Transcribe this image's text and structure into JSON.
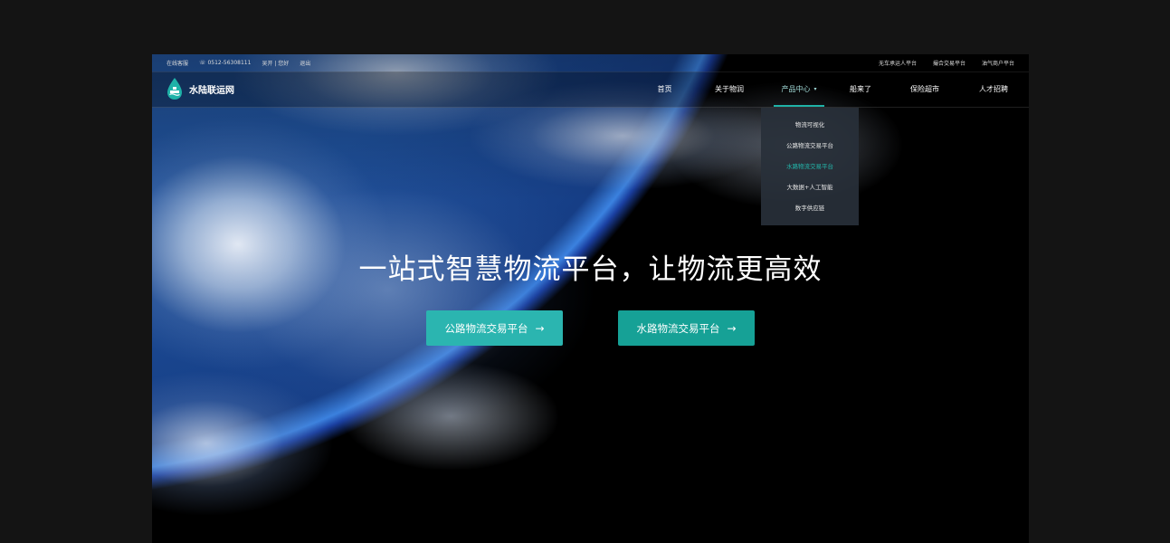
{
  "topbar": {
    "service": "在线客服",
    "phone": "0512-56308111",
    "user": "吴开 | 您好",
    "logout": "退出",
    "links": [
      "无车承运人平台",
      "撮合交易平台",
      "油气商户平台"
    ]
  },
  "brand": {
    "name": "水陆联运网"
  },
  "nav": {
    "items": [
      "首页",
      "关于物润",
      "产品中心",
      "船来了",
      "保险超市",
      "人才招聘"
    ],
    "active_index": 2
  },
  "dropdown": {
    "items": [
      "物流可视化",
      "公路物流交易平台",
      "水路物流交易平台",
      "大数据+人工智能",
      "数字供应链"
    ],
    "highlight_index": 2
  },
  "hero": {
    "title": "一站式智慧物流平台，让物流更高效",
    "cta_road": "公路物流交易平台",
    "cta_water": "水路物流交易平台",
    "arrow": "→"
  },
  "colors": {
    "accent": "#1fb2a8",
    "cta_road": "#2bb5b0",
    "cta_water": "#16a196",
    "page_bg": "#141414"
  }
}
